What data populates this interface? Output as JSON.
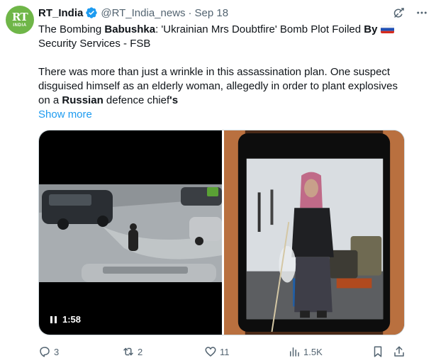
{
  "avatar": {
    "logo_text": "RT",
    "logo_subtext": "INDIA",
    "color": "#6fb648"
  },
  "header": {
    "name": "RT_India",
    "handle": "@RT_India_news",
    "separator": "·",
    "date": "Sep 18",
    "verified_color": "#1d9bf0"
  },
  "tweet": {
    "line1_pre": "The Bombing ",
    "line1_bold1": "Babushka",
    "line1_mid": ": 'Ukrainian Mrs Doubtfire' Bomb Plot Foiled ",
    "line1_bold2": "By",
    "line2": "Security Services - FSB",
    "para2_pre": "There was more than just a wrinkle in this assassination plan. One suspect disguised himself as an elderly woman, allegedly in order to plant explosives on a ",
    "para2_bold1": "Russian",
    "para2_mid": " defence chief",
    "para2_bold2": "'s",
    "show_more": "Show more"
  },
  "media": {
    "video_duration": "1:58",
    "video_watermark_color": "#5aa135"
  },
  "actions": {
    "replies": "3",
    "reposts": "2",
    "likes": "11",
    "views": "1.5K"
  },
  "icons": [
    "verified-icon",
    "grok-icon",
    "more-icon",
    "reply-icon",
    "repost-icon",
    "like-icon",
    "views-icon",
    "bookmark-icon",
    "share-icon",
    "pause-icon"
  ]
}
